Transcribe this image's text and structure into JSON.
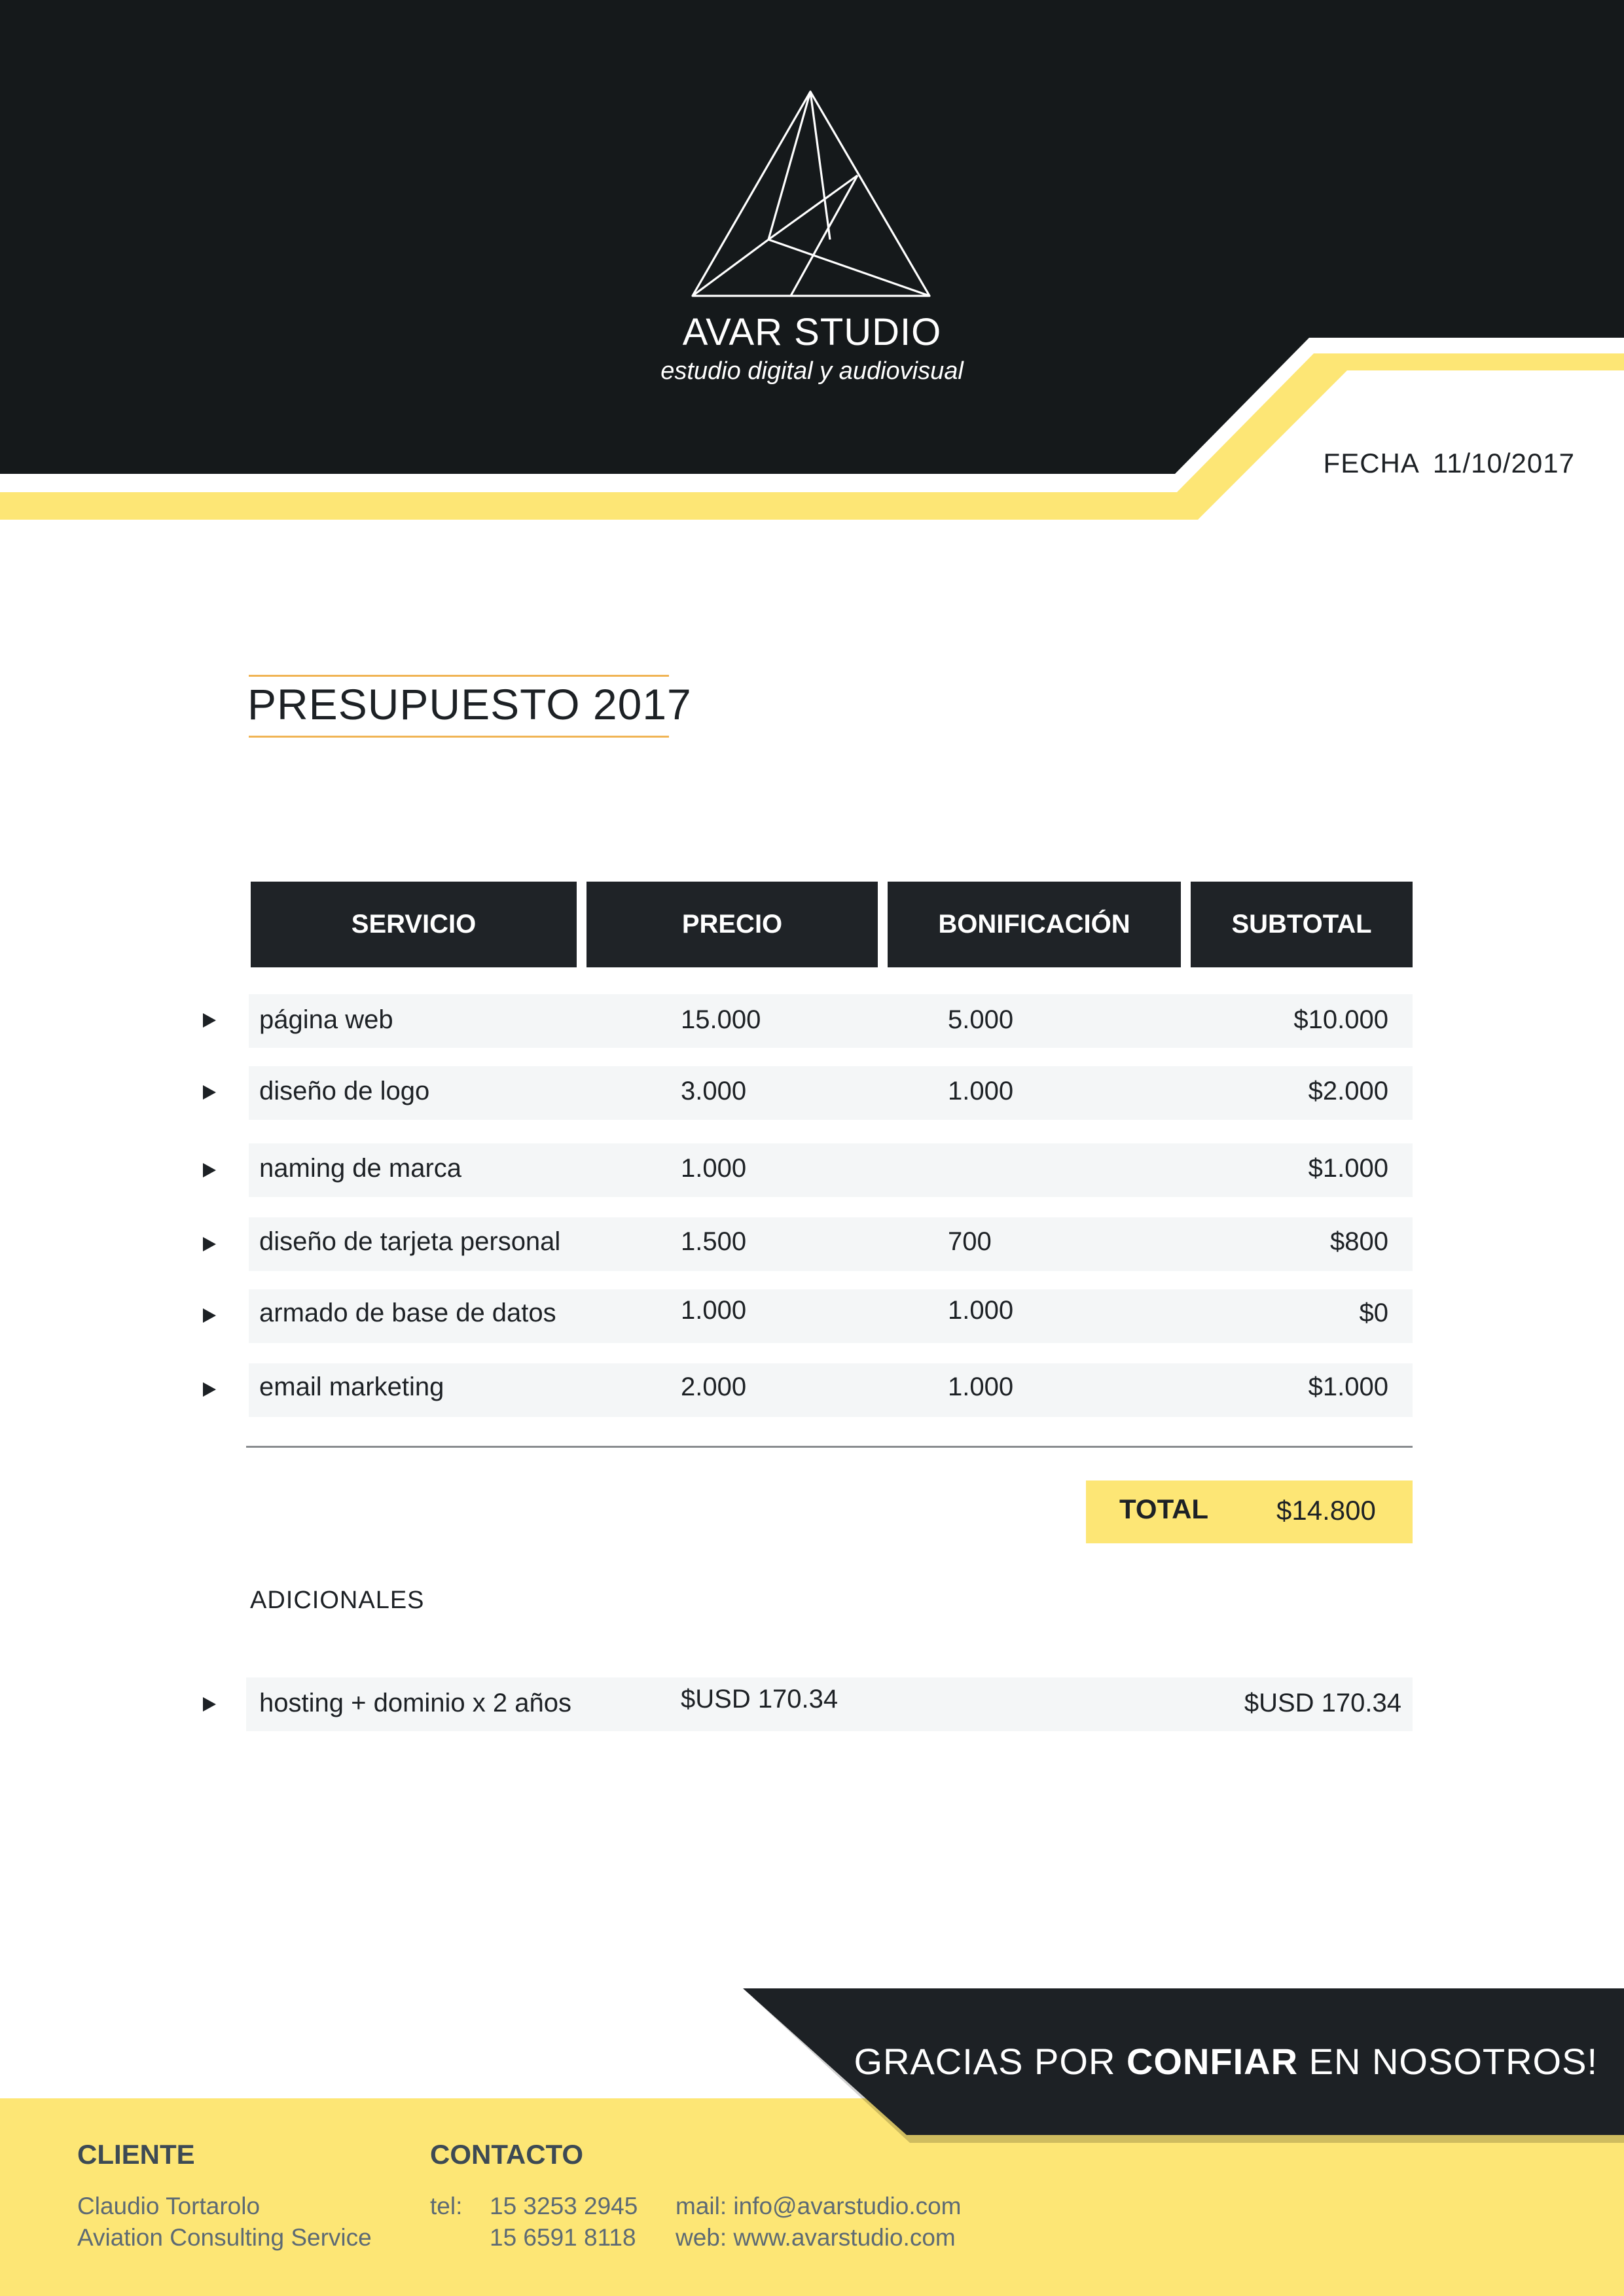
{
  "brand": {
    "name": "AVAR STUDIO",
    "tagline": "estudio digital y audiovisual",
    "logo": "triangle-geometric-logo"
  },
  "date": {
    "label": "FECHA",
    "value": "11/10/2017"
  },
  "title": "PRESUPUESTO 2017",
  "table": {
    "headers": [
      "SERVICIO",
      "PRECIO",
      "BONIFICACIÓN",
      "SUBTOTAL"
    ],
    "rows": [
      {
        "servicio": "página web",
        "precio": "15.000",
        "bonificacion": "5.000",
        "subtotal": "$10.000"
      },
      {
        "servicio": "diseño de logo",
        "precio": "3.000",
        "bonificacion": "1.000",
        "subtotal": "$2.000"
      },
      {
        "servicio": "naming de marca",
        "precio": "1.000",
        "bonificacion": "",
        "subtotal": "$1.000"
      },
      {
        "servicio": "diseño de tarjeta personal",
        "precio": "1.500",
        "bonificacion": "700",
        "subtotal": "$800"
      },
      {
        "servicio": "armado de base de datos",
        "precio": "1.000",
        "bonificacion": "1.000",
        "subtotal": "$0"
      },
      {
        "servicio": "email marketing",
        "precio": "2.000",
        "bonificacion": "1.000",
        "subtotal": "$1.000"
      }
    ]
  },
  "total": {
    "label": "TOTAL",
    "value": "$14.800"
  },
  "additional": {
    "heading": "ADICIONALES",
    "rows": [
      {
        "servicio": "hosting + dominio x 2 años",
        "precio": "$USD 170.34",
        "subtotal": "$USD 170.34"
      }
    ]
  },
  "thanks": {
    "before": "GRACIAS POR ",
    "bold": "CONFIAR",
    "after": " EN NOSOTROS!"
  },
  "footer": {
    "client": {
      "heading": "CLIENTE",
      "name": "Claudio Tortarolo",
      "company": "Aviation Consulting Service"
    },
    "contact": {
      "heading": "CONTACTO",
      "tel_label": "tel:",
      "phone1": "15 3253 2945",
      "phone2": "15 6591 8118",
      "mail": "mail: info@avarstudio.com",
      "web": "web: www.avarstudio.com"
    }
  },
  "colors": {
    "dark": "#15191b",
    "yellow": "#fde675",
    "accent_line": "#f0b454"
  }
}
